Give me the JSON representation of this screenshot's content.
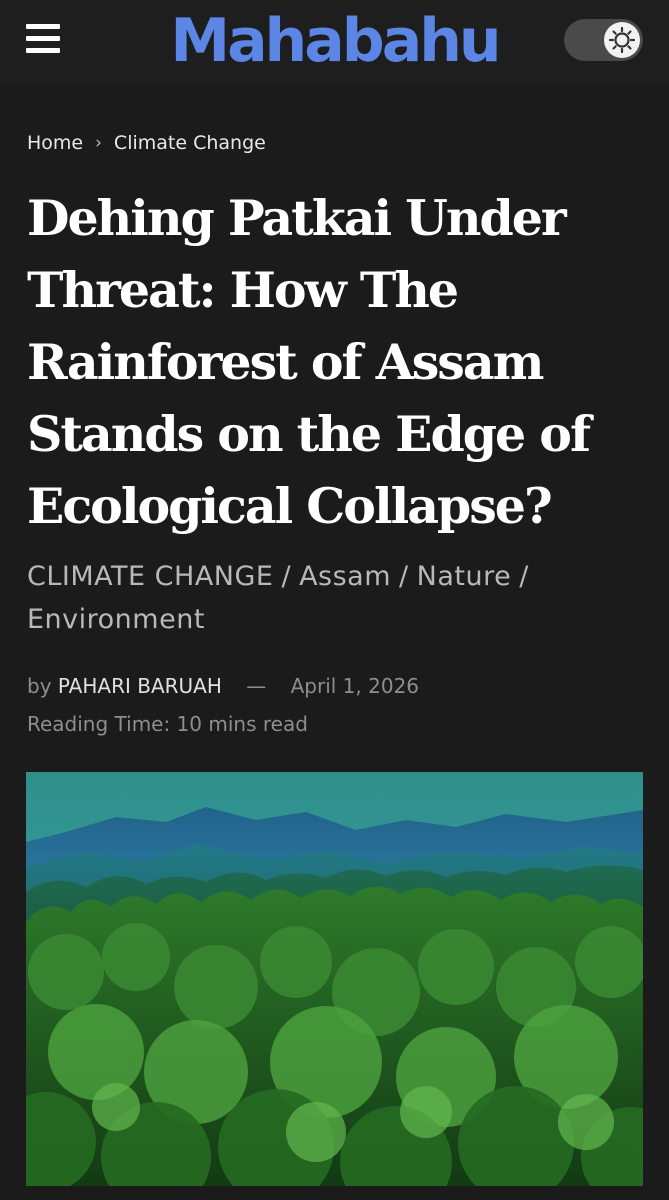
{
  "header": {
    "logo_text": "Mahabahu",
    "logo_color": "#5b86e5",
    "menu_icon": "hamburger-menu-icon",
    "theme_toggle_icon": "sun-gear-icon"
  },
  "breadcrumb": {
    "home": "Home",
    "separator": "›",
    "current": "Climate Change"
  },
  "article": {
    "title": "Dehing Patkai Under Threat: How The Rainforest of Assam Stands on the Edge of Ecological Collapse?",
    "categories": [
      "CLIMATE CHANGE",
      "Assam",
      "Nature",
      "Environment"
    ],
    "category_separator": "/",
    "by_label": "by",
    "author": "PAHARI BARUAH",
    "date_separator": "—",
    "date": "April 1, 2026",
    "reading_time": "Reading Time: 10 mins read"
  },
  "theme": {
    "background": "#1b1b1b",
    "text": "#ffffff",
    "muted": "#8e8e8e"
  }
}
